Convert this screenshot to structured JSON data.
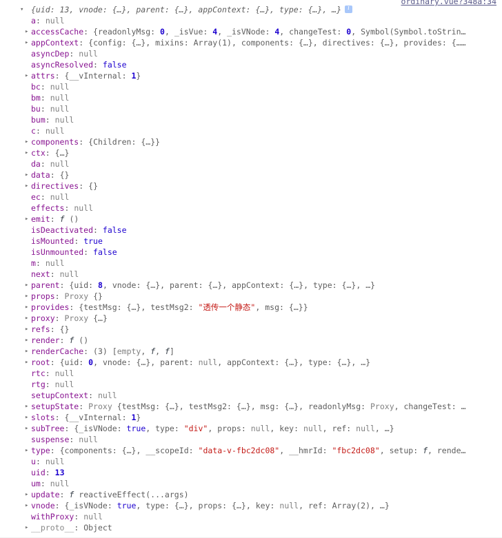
{
  "panel": {
    "name": "console-object-inspector",
    "source_link": "ordinary.vue?348a:34",
    "info_icon": "info-icon"
  },
  "header": {
    "text": "{uid: 13, vnode: {…}, parent: {…}, appContext: {…}, type: {…}, …}",
    "expanded": true
  },
  "rows": [
    {
      "name": "a",
      "expandable": false,
      "text": "a: null"
    },
    {
      "name": "accessCache",
      "expandable": true,
      "text": "accessCache: {readonlyMsg: 0, _isVue: 4, _isVNode: 4, changeTest: 0, Symbol(Symbol.toStrin…"
    },
    {
      "name": "appContext",
      "expandable": true,
      "text": "appContext: {config: {…}, mixins: Array(1), components: {…}, directives: {…}, provides: {……"
    },
    {
      "name": "asyncDep",
      "expandable": false,
      "text": "asyncDep: null"
    },
    {
      "name": "asyncResolved",
      "expandable": false,
      "text": "asyncResolved: false"
    },
    {
      "name": "attrs",
      "expandable": true,
      "text": "attrs: {__vInternal: 1}"
    },
    {
      "name": "bc",
      "expandable": false,
      "text": "bc: null"
    },
    {
      "name": "bm",
      "expandable": false,
      "text": "bm: null"
    },
    {
      "name": "bu",
      "expandable": false,
      "text": "bu: null"
    },
    {
      "name": "bum",
      "expandable": false,
      "text": "bum: null"
    },
    {
      "name": "c",
      "expandable": false,
      "text": "c: null"
    },
    {
      "name": "components",
      "expandable": true,
      "text": "components: {Children: {…}}"
    },
    {
      "name": "ctx",
      "expandable": true,
      "text": "ctx: {…}"
    },
    {
      "name": "da",
      "expandable": false,
      "text": "da: null"
    },
    {
      "name": "data",
      "expandable": true,
      "text": "data: {}"
    },
    {
      "name": "directives",
      "expandable": true,
      "text": "directives: {}"
    },
    {
      "name": "ec",
      "expandable": false,
      "text": "ec: null"
    },
    {
      "name": "effects",
      "expandable": false,
      "text": "effects: null"
    },
    {
      "name": "emit",
      "expandable": true,
      "text": "emit: f ()"
    },
    {
      "name": "isDeactivated",
      "expandable": false,
      "text": "isDeactivated: false"
    },
    {
      "name": "isMounted",
      "expandable": false,
      "text": "isMounted: true"
    },
    {
      "name": "isUnmounted",
      "expandable": false,
      "text": "isUnmounted: false"
    },
    {
      "name": "m",
      "expandable": false,
      "text": "m: null"
    },
    {
      "name": "next",
      "expandable": false,
      "text": "next: null"
    },
    {
      "name": "parent",
      "expandable": true,
      "text": "parent: {uid: 8, vnode: {…}, parent: {…}, appContext: {…}, type: {…}, …}"
    },
    {
      "name": "props",
      "expandable": true,
      "text": "props: Proxy {}"
    },
    {
      "name": "provides",
      "expandable": true,
      "text": "provides: {testMsg: {…}, testMsg2: \"透传一个静态\", msg: {…}}"
    },
    {
      "name": "proxy",
      "expandable": true,
      "text": "proxy: Proxy {…}"
    },
    {
      "name": "refs",
      "expandable": true,
      "text": "refs: {}"
    },
    {
      "name": "render",
      "expandable": true,
      "text": "render: f ()"
    },
    {
      "name": "renderCache",
      "expandable": true,
      "text": "renderCache: (3) [empty, f, f]"
    },
    {
      "name": "root",
      "expandable": true,
      "text": "root: {uid: 0, vnode: {…}, parent: null, appContext: {…}, type: {…}, …}"
    },
    {
      "name": "rtc",
      "expandable": false,
      "text": "rtc: null"
    },
    {
      "name": "rtg",
      "expandable": false,
      "text": "rtg: null"
    },
    {
      "name": "setupContext",
      "expandable": false,
      "text": "setupContext: null"
    },
    {
      "name": "setupState",
      "expandable": true,
      "text": "setupState: Proxy {testMsg: {…}, testMsg2: {…}, msg: {…}, readonlyMsg: Proxy, changeTest: …"
    },
    {
      "name": "slots",
      "expandable": true,
      "text": "slots: {__vInternal: 1}"
    },
    {
      "name": "subTree",
      "expandable": true,
      "text": "subTree: {_isVNode: true, type: \"div\", props: null, key: null, ref: null, …}"
    },
    {
      "name": "suspense",
      "expandable": false,
      "text": "suspense: null"
    },
    {
      "name": "type",
      "expandable": true,
      "text": "type: {components: {…}, __scopeId: \"data-v-fbc2dc08\", __hmrId: \"fbc2dc08\", setup: f, rende…"
    },
    {
      "name": "u",
      "expandable": false,
      "text": "u: null"
    },
    {
      "name": "uid",
      "expandable": false,
      "text": "uid: 13"
    },
    {
      "name": "um",
      "expandable": false,
      "text": "um: null"
    },
    {
      "name": "update",
      "expandable": true,
      "text": "update: f reactiveEffect(...args)"
    },
    {
      "name": "vnode",
      "expandable": true,
      "text": "vnode: {_isVNode: true, type: {…}, props: {…}, key: null, ref: Array(2), …}"
    },
    {
      "name": "withProxy",
      "expandable": false,
      "text": "withProxy: null"
    },
    {
      "name": "__proto__",
      "expandable": true,
      "text": "__proto__: Object"
    }
  ],
  "colors": {
    "property": "#881391",
    "string": "#c41a16",
    "number": "#1c00cf",
    "boolean": "#1c00cf",
    "null": "#808080",
    "preview": "#5d5d5d",
    "background": "#ffffff"
  }
}
